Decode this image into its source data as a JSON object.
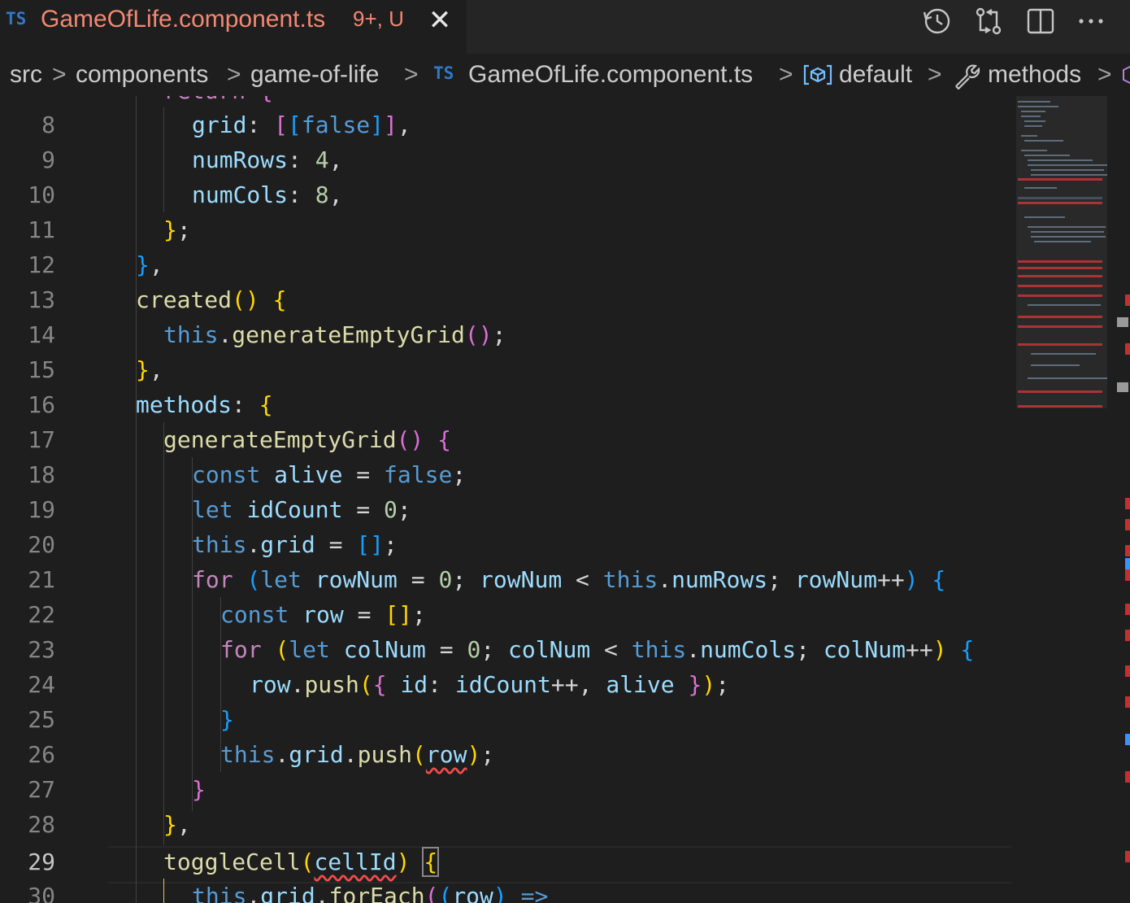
{
  "tab": {
    "language_badge": "TS",
    "title": "GameOfLife.component.ts",
    "status": "9+, U",
    "close_symbol": "✕"
  },
  "actions": [
    "history-icon",
    "compare-changes-icon",
    "split-editor-icon",
    "more-actions-icon"
  ],
  "breadcrumb": {
    "items": [
      "src",
      "components",
      "game-of-life"
    ],
    "file_badge": "TS",
    "file": "GameOfLife.component.ts",
    "symbol_default": "default",
    "symbol_methods": "methods",
    "separator": ">"
  },
  "editor": {
    "line_numbers": [
      "8",
      "9",
      "10",
      "11",
      "12",
      "13",
      "14",
      "15",
      "16",
      "17",
      "18",
      "19",
      "20",
      "21",
      "22",
      "23",
      "24",
      "25",
      "26",
      "27",
      "28",
      "29",
      "30"
    ],
    "active_line": "29",
    "tokens": {
      "return_kw": "return",
      "grid": "grid",
      "false": "false",
      "numRows": "numRows",
      "four": "4",
      "numCols": "numCols",
      "eight": "8",
      "created": "created",
      "this": "this",
      "generateEmptyGrid": "generateEmptyGrid",
      "methods": "methods",
      "const": "const",
      "alive": "alive",
      "let": "let",
      "idCount": "idCount",
      "zero": "0",
      "for": "for",
      "rowNum": "rowNum",
      "row": "row",
      "colNum": "colNum",
      "push": "push",
      "id": "id",
      "toggleCell": "toggleCell",
      "cellId": "cellId",
      "forEach": "forEach"
    }
  },
  "colors": {
    "background": "#1e1e1e",
    "tab_title": "#f48771",
    "keyword": "#569cd6",
    "variable": "#9cdcfe",
    "function": "#dcdcaa",
    "number": "#b5cea8",
    "error": "#f14c4c"
  }
}
